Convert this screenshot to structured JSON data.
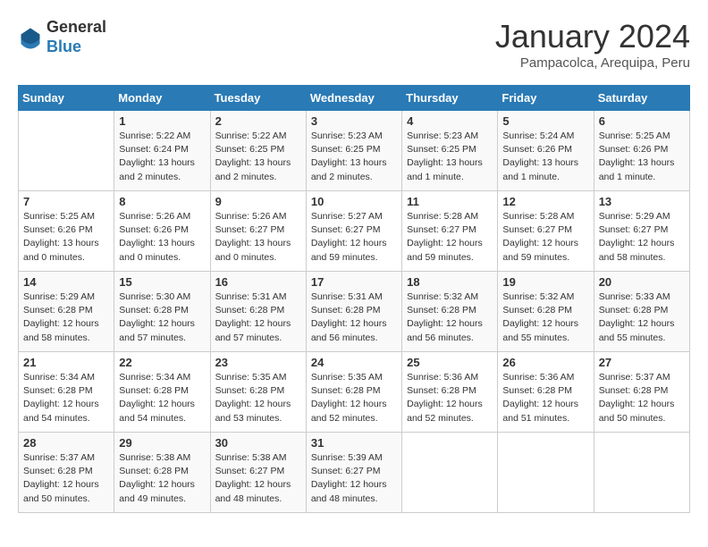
{
  "header": {
    "logo_general": "General",
    "logo_blue": "Blue",
    "title": "January 2024",
    "subtitle": "Pampacolca, Arequipa, Peru"
  },
  "days_of_week": [
    "Sunday",
    "Monday",
    "Tuesday",
    "Wednesday",
    "Thursday",
    "Friday",
    "Saturday"
  ],
  "weeks": [
    [
      {
        "day": "",
        "info": ""
      },
      {
        "day": "1",
        "info": "Sunrise: 5:22 AM\nSunset: 6:24 PM\nDaylight: 13 hours\nand 2 minutes."
      },
      {
        "day": "2",
        "info": "Sunrise: 5:22 AM\nSunset: 6:25 PM\nDaylight: 13 hours\nand 2 minutes."
      },
      {
        "day": "3",
        "info": "Sunrise: 5:23 AM\nSunset: 6:25 PM\nDaylight: 13 hours\nand 2 minutes."
      },
      {
        "day": "4",
        "info": "Sunrise: 5:23 AM\nSunset: 6:25 PM\nDaylight: 13 hours\nand 1 minute."
      },
      {
        "day": "5",
        "info": "Sunrise: 5:24 AM\nSunset: 6:26 PM\nDaylight: 13 hours\nand 1 minute."
      },
      {
        "day": "6",
        "info": "Sunrise: 5:25 AM\nSunset: 6:26 PM\nDaylight: 13 hours\nand 1 minute."
      }
    ],
    [
      {
        "day": "7",
        "info": "Sunrise: 5:25 AM\nSunset: 6:26 PM\nDaylight: 13 hours\nand 0 minutes."
      },
      {
        "day": "8",
        "info": "Sunrise: 5:26 AM\nSunset: 6:26 PM\nDaylight: 13 hours\nand 0 minutes."
      },
      {
        "day": "9",
        "info": "Sunrise: 5:26 AM\nSunset: 6:27 PM\nDaylight: 13 hours\nand 0 minutes."
      },
      {
        "day": "10",
        "info": "Sunrise: 5:27 AM\nSunset: 6:27 PM\nDaylight: 12 hours\nand 59 minutes."
      },
      {
        "day": "11",
        "info": "Sunrise: 5:28 AM\nSunset: 6:27 PM\nDaylight: 12 hours\nand 59 minutes."
      },
      {
        "day": "12",
        "info": "Sunrise: 5:28 AM\nSunset: 6:27 PM\nDaylight: 12 hours\nand 59 minutes."
      },
      {
        "day": "13",
        "info": "Sunrise: 5:29 AM\nSunset: 6:27 PM\nDaylight: 12 hours\nand 58 minutes."
      }
    ],
    [
      {
        "day": "14",
        "info": "Sunrise: 5:29 AM\nSunset: 6:28 PM\nDaylight: 12 hours\nand 58 minutes."
      },
      {
        "day": "15",
        "info": "Sunrise: 5:30 AM\nSunset: 6:28 PM\nDaylight: 12 hours\nand 57 minutes."
      },
      {
        "day": "16",
        "info": "Sunrise: 5:31 AM\nSunset: 6:28 PM\nDaylight: 12 hours\nand 57 minutes."
      },
      {
        "day": "17",
        "info": "Sunrise: 5:31 AM\nSunset: 6:28 PM\nDaylight: 12 hours\nand 56 minutes."
      },
      {
        "day": "18",
        "info": "Sunrise: 5:32 AM\nSunset: 6:28 PM\nDaylight: 12 hours\nand 56 minutes."
      },
      {
        "day": "19",
        "info": "Sunrise: 5:32 AM\nSunset: 6:28 PM\nDaylight: 12 hours\nand 55 minutes."
      },
      {
        "day": "20",
        "info": "Sunrise: 5:33 AM\nSunset: 6:28 PM\nDaylight: 12 hours\nand 55 minutes."
      }
    ],
    [
      {
        "day": "21",
        "info": "Sunrise: 5:34 AM\nSunset: 6:28 PM\nDaylight: 12 hours\nand 54 minutes."
      },
      {
        "day": "22",
        "info": "Sunrise: 5:34 AM\nSunset: 6:28 PM\nDaylight: 12 hours\nand 54 minutes."
      },
      {
        "day": "23",
        "info": "Sunrise: 5:35 AM\nSunset: 6:28 PM\nDaylight: 12 hours\nand 53 minutes."
      },
      {
        "day": "24",
        "info": "Sunrise: 5:35 AM\nSunset: 6:28 PM\nDaylight: 12 hours\nand 52 minutes."
      },
      {
        "day": "25",
        "info": "Sunrise: 5:36 AM\nSunset: 6:28 PM\nDaylight: 12 hours\nand 52 minutes."
      },
      {
        "day": "26",
        "info": "Sunrise: 5:36 AM\nSunset: 6:28 PM\nDaylight: 12 hours\nand 51 minutes."
      },
      {
        "day": "27",
        "info": "Sunrise: 5:37 AM\nSunset: 6:28 PM\nDaylight: 12 hours\nand 50 minutes."
      }
    ],
    [
      {
        "day": "28",
        "info": "Sunrise: 5:37 AM\nSunset: 6:28 PM\nDaylight: 12 hours\nand 50 minutes."
      },
      {
        "day": "29",
        "info": "Sunrise: 5:38 AM\nSunset: 6:28 PM\nDaylight: 12 hours\nand 49 minutes."
      },
      {
        "day": "30",
        "info": "Sunrise: 5:38 AM\nSunset: 6:27 PM\nDaylight: 12 hours\nand 48 minutes."
      },
      {
        "day": "31",
        "info": "Sunrise: 5:39 AM\nSunset: 6:27 PM\nDaylight: 12 hours\nand 48 minutes."
      },
      {
        "day": "",
        "info": ""
      },
      {
        "day": "",
        "info": ""
      },
      {
        "day": "",
        "info": ""
      }
    ]
  ]
}
